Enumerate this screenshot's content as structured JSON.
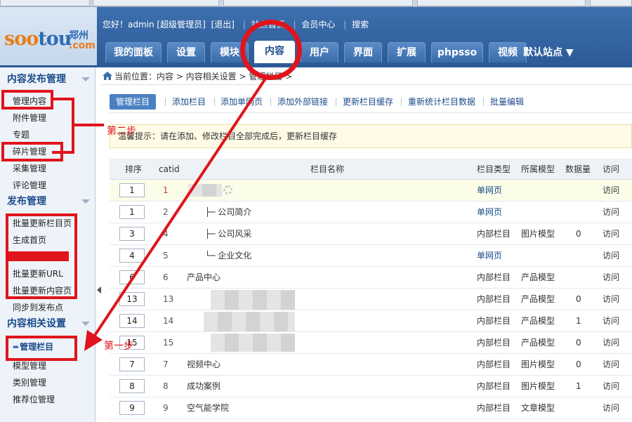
{
  "header": {
    "logo": {
      "soo": "soo",
      "tou": "tou",
      "city": "郑州",
      "com": ".com"
    },
    "userbar": {
      "greeting": "您好！admin [超级管理员]",
      "logout": "[退出]",
      "site_home": "站点首页",
      "member_center": "会员中心",
      "search": "搜索"
    },
    "tabs": [
      "我的面板",
      "设置",
      "模块",
      "内容",
      "用户",
      "界面",
      "扩展",
      "phpsso",
      "视频"
    ],
    "active_tab": "内容",
    "site_select": "默认站点"
  },
  "sidebar": {
    "sections": [
      {
        "title": "内容发布管理",
        "items": [
          "管理内容",
          "附件管理",
          "专题",
          "碎片管理",
          "采集管理",
          "评论管理"
        ]
      },
      {
        "title": "发布管理",
        "items": [
          "批量更新栏目页",
          "生成首页",
          "批量更新URL",
          "批量更新内容页",
          "同步到发布点"
        ]
      },
      {
        "title": "内容相关设置",
        "items": [
          "管理栏目",
          "模型管理",
          "类别管理",
          "推荐位管理"
        ]
      }
    ]
  },
  "breadcrumb": "当前位置：内容 > 内容相关设置 > 管理栏目 >",
  "subnav": [
    "管理栏目",
    "添加栏目",
    "添加单网页",
    "添加外部链接",
    "更新栏目缓存",
    "重新统计栏目数据",
    "批量编辑"
  ],
  "tip": "温馨提示：请在添加、修改栏目全部完成后，更新栏目缓存",
  "table": {
    "headers": {
      "order": "排序",
      "catid": "catid",
      "name": "栏目名称",
      "type": "栏目类型",
      "model": "所属模型",
      "count": "数据量",
      "visit": "访问"
    },
    "rows": [
      {
        "order": "1",
        "catid": "1",
        "name": "",
        "type": "单网页",
        "model": "",
        "count": "",
        "visit": "访问"
      },
      {
        "order": "1",
        "catid": "2",
        "name": "├─ 公司简介",
        "type": "单网页",
        "model": "",
        "count": "",
        "visit": "访问"
      },
      {
        "order": "3",
        "catid": "4",
        "name": "├─ 公司风采",
        "type": "内部栏目",
        "model": "图片模型",
        "count": "0",
        "visit": "访问"
      },
      {
        "order": "4",
        "catid": "5",
        "name": "└─ 企业文化",
        "type": "单网页",
        "model": "",
        "count": "",
        "visit": "访问"
      },
      {
        "order": "6",
        "catid": "6",
        "name": "产品中心",
        "type": "内部栏目",
        "model": "产品模型",
        "count": "",
        "visit": "访问"
      },
      {
        "order": "13",
        "catid": "13",
        "name": "",
        "type": "内部栏目",
        "model": "产品模型",
        "count": "0",
        "visit": "访问"
      },
      {
        "order": "14",
        "catid": "14",
        "name": "",
        "type": "内部栏目",
        "model": "产品模型",
        "count": "1",
        "visit": "访问"
      },
      {
        "order": "15",
        "catid": "15",
        "name": "",
        "type": "内部栏目",
        "model": "产品模型",
        "count": "0",
        "visit": "访问"
      },
      {
        "order": "7",
        "catid": "7",
        "name": "视频中心",
        "type": "内部栏目",
        "model": "图片模型",
        "count": "0",
        "visit": "访问"
      },
      {
        "order": "8",
        "catid": "8",
        "name": "成功案例",
        "type": "内部栏目",
        "model": "图片模型",
        "count": "1",
        "visit": "访问"
      },
      {
        "order": "9",
        "catid": "9",
        "name": "空气能学院",
        "type": "内部栏目",
        "model": "文章模型",
        "count": "",
        "visit": "访问"
      }
    ]
  },
  "annotations": {
    "step1": "第一步",
    "step2": "第二步"
  },
  "colors": {
    "header_blue": "#2c5a96",
    "annotation_red": "#e0141c",
    "link_blue": "#1b4b8a"
  }
}
